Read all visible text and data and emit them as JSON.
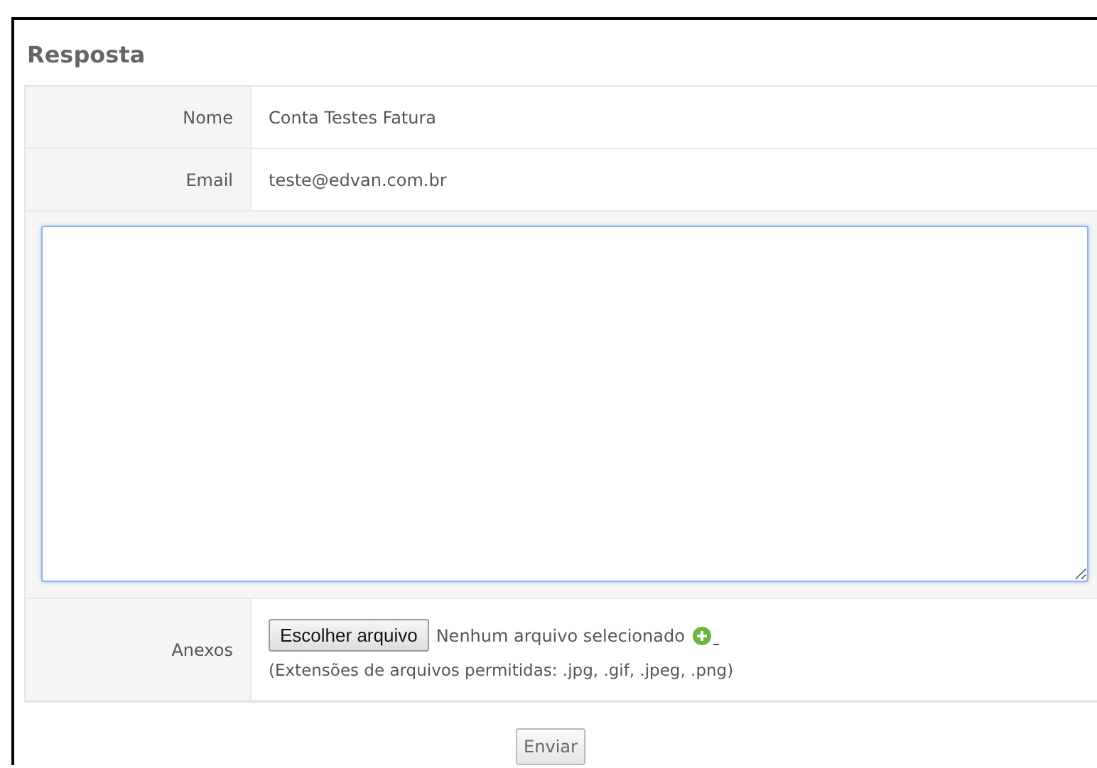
{
  "title": "Resposta",
  "fields": [
    {
      "label": "Nome",
      "value": "Conta Testes Fatura"
    },
    {
      "label": "Email",
      "value": "teste@edvan.com.br"
    }
  ],
  "attachments": {
    "label": "Anexos",
    "button": "Escolher arquivo",
    "status": "Nenhum arquivo selecionado",
    "hint": "(Extensões de arquivos permitidas: .jpg, .gif, .jpeg, .png)"
  },
  "submit": "Enviar"
}
